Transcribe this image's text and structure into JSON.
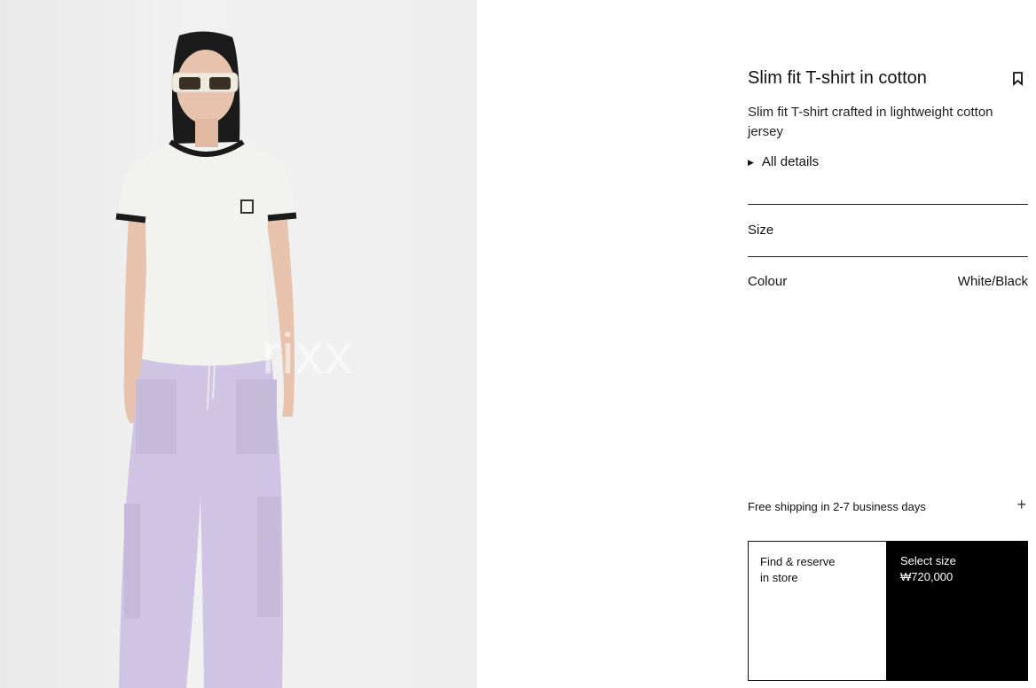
{
  "product": {
    "title": "Slim fit T-shirt in cotton",
    "description": "Slim fit T-shirt crafted in lightweight cotton jersey",
    "details_label": "All details",
    "bookmark_icon": "bookmark-icon",
    "details_icon": "triangle-right-icon"
  },
  "selectors": {
    "size_label": "Size",
    "colour_label": "Colour",
    "colour_value": "White/Black"
  },
  "shipping": {
    "label": "Free shipping in 2-7 business days",
    "expand_icon": "plus-icon"
  },
  "actions": {
    "find_line1": "Find & reserve",
    "find_line2": "in store",
    "select_label": "Select size",
    "price": "₩720,000"
  },
  "image": {
    "watermark": "rixx"
  },
  "colors": {
    "tshirt": "#f2f2ee",
    "trim": "#1a1a1a",
    "pants": "#cfc4e3",
    "button_bg": "#000000"
  }
}
